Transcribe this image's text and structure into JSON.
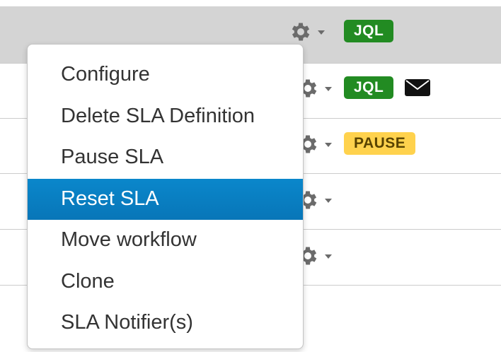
{
  "table": {
    "rows": [
      {
        "badges": [
          "JQL"
        ],
        "has_envelope": false
      },
      {
        "badges": [
          "JQL"
        ],
        "has_envelope": true
      },
      {
        "badges": [
          "PAUSE"
        ],
        "has_envelope": false
      },
      {
        "badges": [],
        "has_envelope": false
      },
      {
        "badges": [],
        "has_envelope": false
      }
    ],
    "badge_labels": {
      "jql": "JQL",
      "pause": "PAUSE"
    },
    "icons": {
      "row_action": "gear-icon",
      "dropdown": "chevron-down-icon",
      "notification": "envelope-icon"
    }
  },
  "menu": {
    "items": [
      {
        "label": "Configure"
      },
      {
        "label": "Delete SLA Definition"
      },
      {
        "label": "Pause SLA"
      },
      {
        "label": "Reset SLA"
      },
      {
        "label": "Move workflow"
      },
      {
        "label": "Clone"
      },
      {
        "label": "SLA Notifier(s)"
      }
    ],
    "active_item": "Reset SLA"
  },
  "colors": {
    "header_bg": "#d4d4d4",
    "jql_badge": "#228b22",
    "pause_badge": "#ffd24d",
    "menu_active": "#0a87cb",
    "gear": "#6b6b6b"
  }
}
